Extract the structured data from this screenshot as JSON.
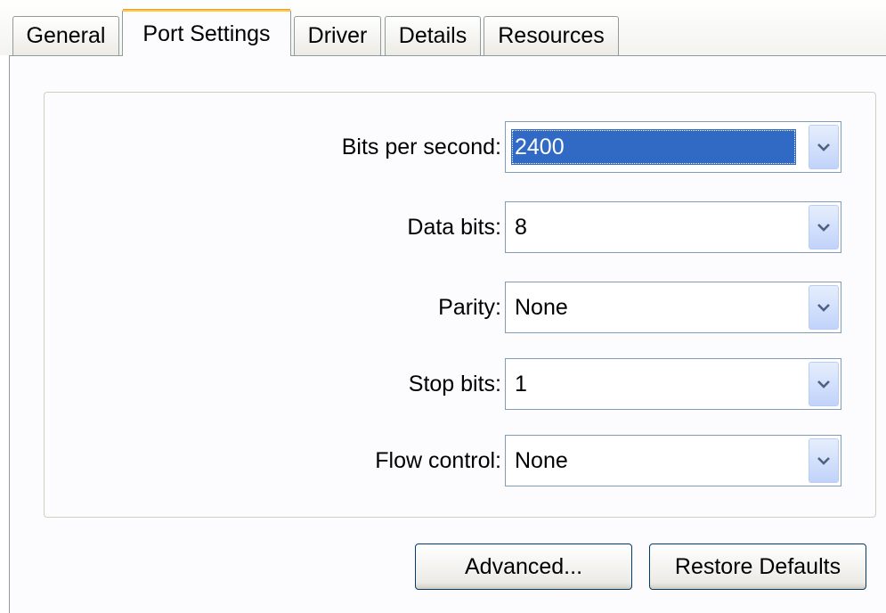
{
  "tabs": [
    {
      "label": "General"
    },
    {
      "label": "Port Settings"
    },
    {
      "label": "Driver"
    },
    {
      "label": "Details"
    },
    {
      "label": "Resources"
    }
  ],
  "active_tab": "Port Settings",
  "settings": {
    "bits_per_second": {
      "label": "Bits per second:",
      "value": "2400"
    },
    "data_bits": {
      "label": "Data bits:",
      "value": "8"
    },
    "parity": {
      "label": "Parity:",
      "value": "None"
    },
    "stop_bits": {
      "label": "Stop bits:",
      "value": "1"
    },
    "flow_control": {
      "label": "Flow control:",
      "value": "None"
    }
  },
  "buttons": {
    "advanced": "Advanced...",
    "restore_defaults": "Restore Defaults"
  },
  "icons": {
    "dropdown": "chevron-down-icon"
  },
  "colors": {
    "selection": "#316ac5",
    "active_tab_highlight": "#ffc83c",
    "combo_border": "#7f9db9"
  }
}
